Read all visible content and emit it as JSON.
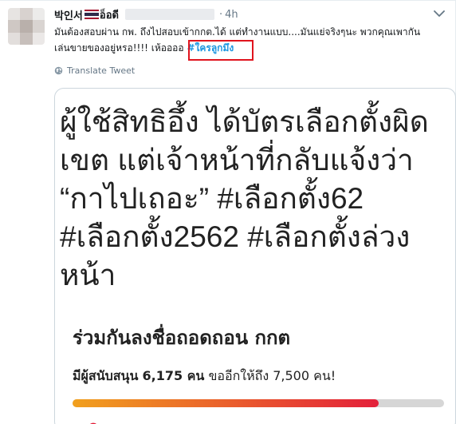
{
  "tweet": {
    "author_name": "박인서",
    "author_suffix": "อ็อดี",
    "separator": "·",
    "time": "4h",
    "text_line1": "มันต้องสอบผ่าน กพ. ถึงไปสอบเข้ากกต.ได้ แต่ทำงานแบบ....มันแย่จริงๆนะ พวกคุณเพากัน",
    "text_line2": "เล่นขายของอยู่หรอ!!!! เห้ออออ",
    "hashtag": "#ใครลูกมึง",
    "translate_label": "Translate Tweet",
    "colors": {
      "hashtag": "#1b95e0",
      "highlight_box": "#e0141e",
      "meta": "#657786"
    }
  },
  "card": {
    "headline_lines": [
      "ผู้ใช้สิทธิอึ้ง ได้บัตรเลือกตั้งผิด",
      "เขต แต่เจ้าหน้าที่กลับแจ้งว่า",
      "“กาไปเถอะ” #เลือกตั้ง62",
      "#เลือกตั้ง2562 #เลือกตั้งล่วง",
      "หน้า"
    ],
    "petition_title": "ร่วมกันลงชื่อถอดถอน กกต",
    "supporters_prefix": "มีผู้สนับสนุน",
    "supporters_count": "6,175 คน",
    "supporters_suffix": "ขออีกให้ถึง 7,500 คน!",
    "progress": {
      "current": 6175,
      "goal": 7500,
      "fraction": 0.823
    },
    "colors": {
      "progress_start": "#f1a01e",
      "progress_end": "#e3203a",
      "track": "#d6d6d6",
      "hearts": "#e3203a"
    }
  },
  "icons": {
    "caret": "chevron-down-icon",
    "globe": "globe-icon",
    "flag": "thai-flag-icon"
  }
}
